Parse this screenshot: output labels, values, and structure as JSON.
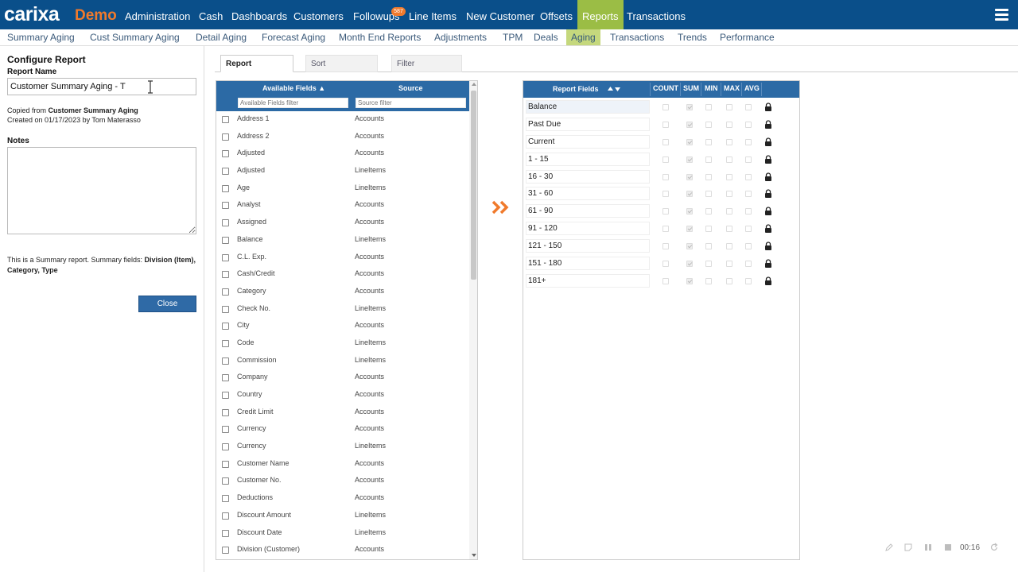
{
  "brand": {
    "logo": "carixa",
    "demo": "Demo"
  },
  "topnav": {
    "items": [
      "Administration",
      "Cash",
      "Dashboards",
      "Customers",
      "Followups",
      "Line Items",
      "New Customer",
      "Offsets",
      "Reports",
      "Transactions"
    ],
    "active": "Reports",
    "followups_badge": "587"
  },
  "subnav": {
    "items": [
      "Summary Aging",
      "Cust Summary Aging",
      "Detail Aging",
      "Forecast Aging",
      "Month End Reports",
      "Adjustments",
      "TPM",
      "Deals",
      "Aging",
      "Transactions",
      "Trends",
      "Performance"
    ],
    "active": "Aging"
  },
  "configure": {
    "title": "Configure Report",
    "report_name_label": "Report Name",
    "report_name_value": "Customer Summary Aging - T",
    "copied_prefix": "Copied from ",
    "copied_from": "Customer Summary Aging",
    "created_line": "Created on 01/17/2023 by Tom Materasso",
    "notes_label": "Notes",
    "notes_value": "",
    "summary_prefix": "This is a Summary report. Summary fields: ",
    "summary_fields": "Division (Item), Category, Type",
    "close_label": "Close"
  },
  "tabs": [
    "Report",
    "Sort",
    "Filter"
  ],
  "available_fields": {
    "col_field": "Available Fields",
    "col_source": "Source",
    "field_filter_placeholder": "Available Fields filter",
    "source_filter_placeholder": "Source filter",
    "rows": [
      {
        "name": "Address 1",
        "source": "Accounts"
      },
      {
        "name": "Address 2",
        "source": "Accounts"
      },
      {
        "name": "Adjusted",
        "source": "Accounts"
      },
      {
        "name": "Adjusted",
        "source": "LineItems"
      },
      {
        "name": "Age",
        "source": "LineItems"
      },
      {
        "name": "Analyst",
        "source": "Accounts"
      },
      {
        "name": "Assigned",
        "source": "Accounts"
      },
      {
        "name": "Balance",
        "source": "LineItems"
      },
      {
        "name": "C.L. Exp.",
        "source": "Accounts"
      },
      {
        "name": "Cash/Credit",
        "source": "Accounts"
      },
      {
        "name": "Category",
        "source": "Accounts"
      },
      {
        "name": "Check No.",
        "source": "LineItems"
      },
      {
        "name": "City",
        "source": "Accounts"
      },
      {
        "name": "Code",
        "source": "LineItems"
      },
      {
        "name": "Commission",
        "source": "LineItems"
      },
      {
        "name": "Company",
        "source": "Accounts"
      },
      {
        "name": "Country",
        "source": "Accounts"
      },
      {
        "name": "Credit Limit",
        "source": "Accounts"
      },
      {
        "name": "Currency",
        "source": "Accounts"
      },
      {
        "name": "Currency",
        "source": "LineItems"
      },
      {
        "name": "Customer Name",
        "source": "Accounts"
      },
      {
        "name": "Customer No.",
        "source": "Accounts"
      },
      {
        "name": "Deductions",
        "source": "Accounts"
      },
      {
        "name": "Discount Amount",
        "source": "LineItems"
      },
      {
        "name": "Discount Date",
        "source": "LineItems"
      },
      {
        "name": "Division (Customer)",
        "source": "Accounts"
      }
    ]
  },
  "report_fields": {
    "col_field": "Report Fields",
    "columns": [
      "COUNT",
      "SUM",
      "MIN",
      "MAX",
      "AVG"
    ],
    "rows": [
      {
        "name": "Balance",
        "sum": true
      },
      {
        "name": "Past Due",
        "sum": true
      },
      {
        "name": "Current",
        "sum": true
      },
      {
        "name": "1 - 15",
        "sum": true
      },
      {
        "name": "16 - 30",
        "sum": true
      },
      {
        "name": "31 - 60",
        "sum": true
      },
      {
        "name": "61 - 90",
        "sum": true
      },
      {
        "name": "91 - 120",
        "sum": true
      },
      {
        "name": "121 - 150",
        "sum": true
      },
      {
        "name": "151 - 180",
        "sum": true
      },
      {
        "name": "181+",
        "sum": true
      }
    ]
  },
  "recorder": {
    "time": "00:16"
  },
  "colors": {
    "nav": "#0a4f8a",
    "accent": "#f07a2c",
    "active_tab": "#9bbd45",
    "header_blue": "#2c6aa5"
  }
}
